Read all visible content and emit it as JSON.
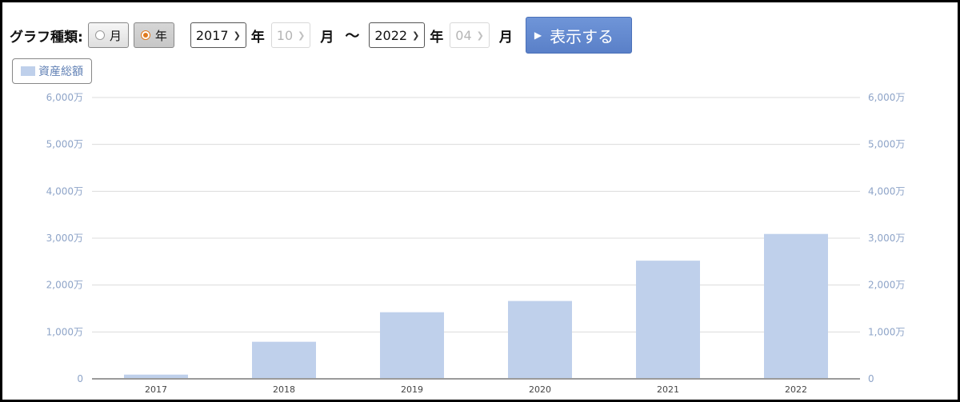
{
  "controls": {
    "graph_type_label": "グラフ種類:",
    "radio_month": "月",
    "radio_year": "年",
    "start_year": "2017",
    "start_year_unit": "年",
    "start_month": "10",
    "start_month_unit": "月",
    "range_sep": "〜",
    "end_year": "2022",
    "end_year_unit": "年",
    "end_month": "04",
    "end_month_unit": "月",
    "show_button": "表示する"
  },
  "colors": {
    "bar": "#bfd0eb",
    "accent": "#5a80c8",
    "radio_selected": "#e07a1e"
  },
  "chart_data": {
    "type": "bar",
    "categories": [
      "2017",
      "2018",
      "2019",
      "2020",
      "2021",
      "2022"
    ],
    "series": [
      {
        "name": "資産総額",
        "values": [
          90,
          790,
          1420,
          1660,
          2520,
          3090
        ]
      }
    ],
    "ylim": [
      0,
      6000
    ],
    "yticks": [
      0,
      1000,
      2000,
      3000,
      4000,
      5000,
      6000
    ],
    "ytick_labels": [
      "0",
      "1,000万",
      "2,000万",
      "3,000万",
      "4,000万",
      "5,000万",
      "6,000万"
    ],
    "dual_y_axis": true,
    "grid": true,
    "legend": "top-left"
  }
}
